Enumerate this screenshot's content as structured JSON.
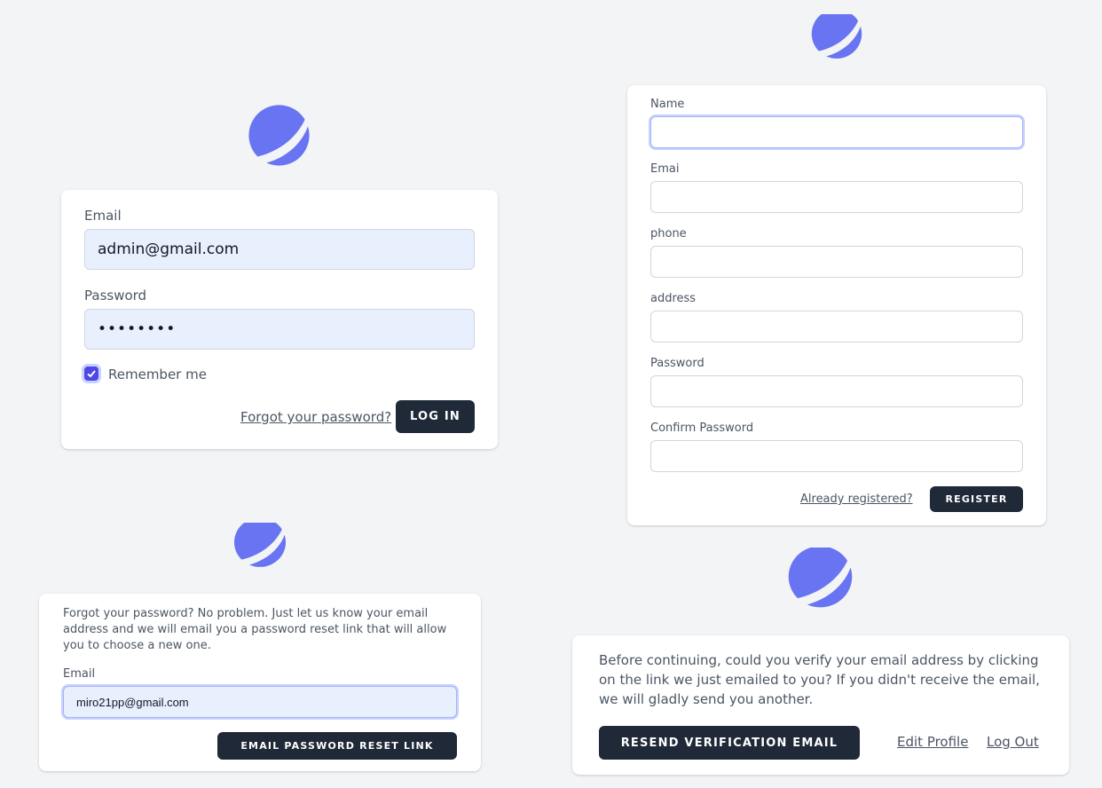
{
  "colors": {
    "logo": "#6874f1",
    "accent": "#4f46e5",
    "button": "#1f2937",
    "autofill": "#e8f0fe",
    "background": "#f3f4f6"
  },
  "login": {
    "email_label": "Email",
    "email_value": "admin@gmail.com",
    "password_label": "Password",
    "password_value": "••••••••",
    "remember_label": "Remember me",
    "remember_checked": true,
    "forgot_link": "Forgot your password?",
    "login_button": "Log in"
  },
  "register": {
    "name_label": "Name",
    "email_label": "Emai",
    "phone_label": "phone",
    "address_label": "address",
    "password_label": "Password",
    "confirm_label": "Confirm Password",
    "already_link": "Already registered?",
    "register_button": "Register"
  },
  "forgot": {
    "description": "Forgot your password? No problem. Just let us know your email address and we will email you a password reset link that will allow you to choose a new one.",
    "email_label": "Email",
    "email_value": "miro21pp@gmail.com",
    "reset_button": "Email Password Reset Link"
  },
  "verify": {
    "description": "Before continuing, could you verify your email address by clicking on the link we just emailed to you? If you didn't receive the email, we will gladly send you another.",
    "resend_button": "Resend Verification Email",
    "edit_profile_link": "Edit Profile",
    "logout_link": "Log Out"
  }
}
